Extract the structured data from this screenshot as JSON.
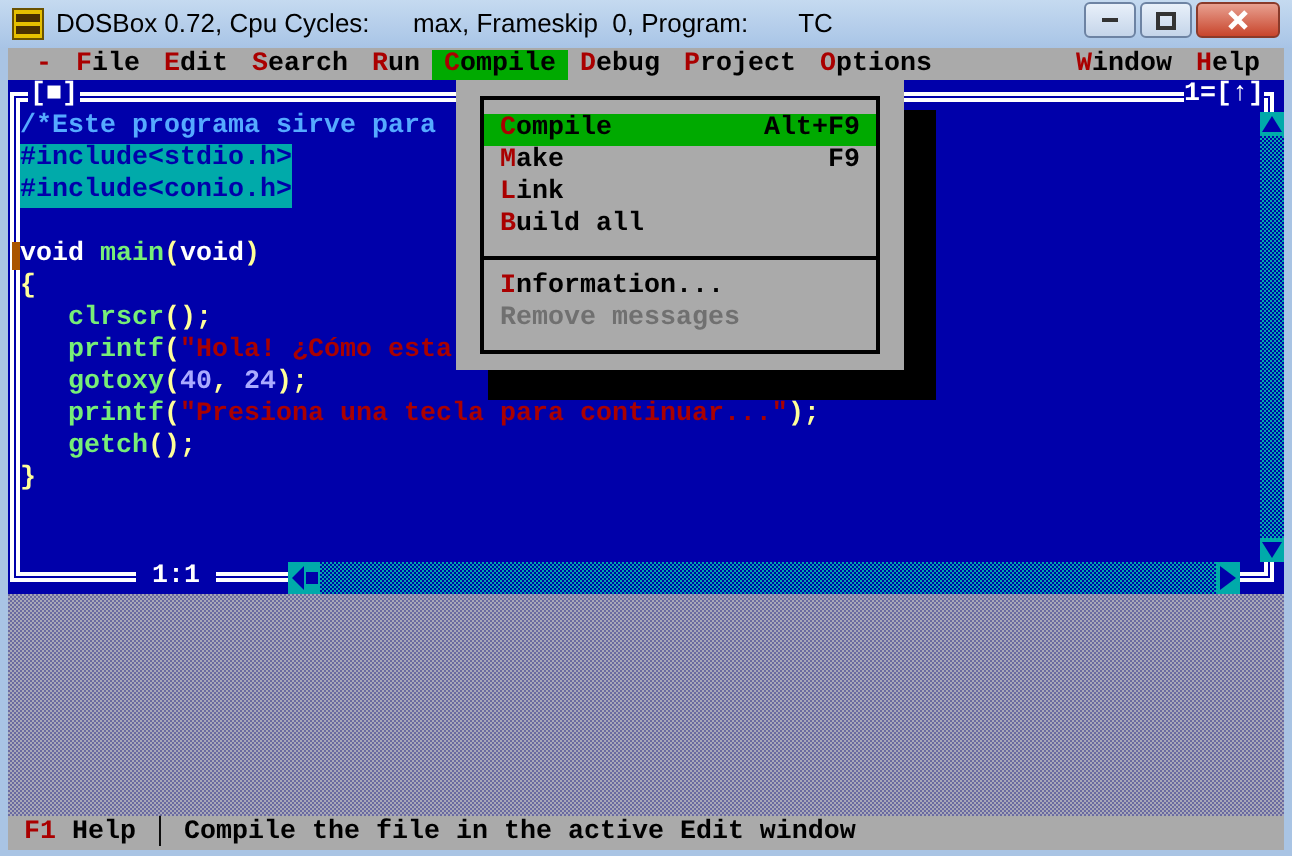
{
  "window": {
    "title": "DOSBox 0.72, Cpu Cycles:      max, Frameskip  0, Program:       TC"
  },
  "menu_bar": [
    {
      "hotkey": "-",
      "selected": false
    },
    {
      "hotkey": "F",
      "rest": "ile",
      "selected": false
    },
    {
      "hotkey": "E",
      "rest": "dit",
      "selected": false
    },
    {
      "hotkey": "S",
      "rest": "earch",
      "selected": false
    },
    {
      "hotkey": "R",
      "rest": "un",
      "selected": false
    },
    {
      "hotkey": "C",
      "rest": "ompile",
      "selected": true
    },
    {
      "hotkey": "D",
      "rest": "ebug",
      "selected": false
    },
    {
      "hotkey": "P",
      "rest": "roject",
      "selected": false
    },
    {
      "hotkey": "O",
      "rest": "ptions",
      "selected": false
    }
  ],
  "right_menu": [
    {
      "hotkey": "W",
      "rest": "indow",
      "selected": false
    },
    {
      "hotkey": "H",
      "rest": "elp",
      "selected": false
    }
  ],
  "editor": {
    "close_box": "[■]",
    "window_number": "1=[↑]",
    "position": "1:1",
    "lines": [
      {
        "cursor": false,
        "tokens": [
          {
            "kind": "comment",
            "text": "/*Este programa sirve para"
          }
        ]
      },
      {
        "cursor": false,
        "tokens": [
          {
            "kind": "preproc",
            "text": "#include<stdio.h>"
          }
        ]
      },
      {
        "cursor": false,
        "tokens": [
          {
            "kind": "preproc",
            "text": "#include<conio.h>"
          }
        ]
      },
      {
        "cursor": false
      },
      {
        "cursor": true,
        "tokens": [
          {
            "kind": "plain",
            "text": "void "
          },
          {
            "kind": "ident",
            "text": "main"
          },
          {
            "kind": "punct",
            "text": "("
          },
          {
            "kind": "plain",
            "text": "void"
          },
          {
            "kind": "punct",
            "text": ")"
          }
        ]
      },
      {
        "cursor": false,
        "tokens": [
          {
            "kind": "punct",
            "text": "{"
          }
        ]
      },
      {
        "cursor": false,
        "indented": true,
        "tokens": [
          {
            "kind": "ident",
            "text": "clrscr"
          },
          {
            "kind": "punct",
            "text": "();"
          }
        ]
      },
      {
        "cursor": false,
        "indented": true,
        "tokens": [
          {
            "kind": "ident",
            "text": "printf"
          },
          {
            "kind": "punct",
            "text": "("
          },
          {
            "kind": "string",
            "text": "\"Hola! ¿Cómo esta"
          }
        ]
      },
      {
        "cursor": false,
        "indented": true,
        "tokens": [
          {
            "kind": "ident",
            "text": "gotoxy"
          },
          {
            "kind": "punct",
            "text": "("
          },
          {
            "kind": "number",
            "text": "40"
          },
          {
            "kind": "punct",
            "text": ", "
          },
          {
            "kind": "number",
            "text": "24"
          },
          {
            "kind": "punct",
            "text": ");"
          }
        ]
      },
      {
        "cursor": false,
        "indented": true,
        "tokens": [
          {
            "kind": "ident",
            "text": "printf"
          },
          {
            "kind": "punct",
            "text": "("
          },
          {
            "kind": "string",
            "text": "\"Presiona una tecla para continuar...\""
          },
          {
            "kind": "punct",
            "text": ");"
          }
        ]
      },
      {
        "cursor": false,
        "indented": true,
        "tokens": [
          {
            "kind": "ident",
            "text": "getch"
          },
          {
            "kind": "punct",
            "text": "();"
          }
        ]
      },
      {
        "cursor": false,
        "tokens": [
          {
            "kind": "punct",
            "text": "}"
          }
        ]
      }
    ]
  },
  "compile_menu": {
    "items": [
      {
        "kind": "item",
        "hotkey": "C",
        "rest": "ompile",
        "shortcut": "Alt+F9",
        "selected": true,
        "disabled": false
      },
      {
        "kind": "item",
        "hotkey": "M",
        "rest": "ake",
        "shortcut": "F9",
        "selected": false,
        "disabled": false
      },
      {
        "kind": "item",
        "hotkey": "L",
        "rest": "ink",
        "selected": false,
        "disabled": false
      },
      {
        "kind": "item",
        "hotkey": "B",
        "rest": "uild all",
        "selected": false,
        "disabled": false
      },
      {
        "kind": "separator"
      },
      {
        "kind": "item",
        "hotkey": "I",
        "rest": "nformation...",
        "selected": false,
        "disabled": false
      },
      {
        "kind": "item",
        "text": "Remove messages",
        "selected": false,
        "disabled": true
      }
    ]
  },
  "status_bar": {
    "key": "F1",
    "key_label": "Help",
    "divider": "│",
    "message": "Compile the file in the active Edit window"
  }
}
